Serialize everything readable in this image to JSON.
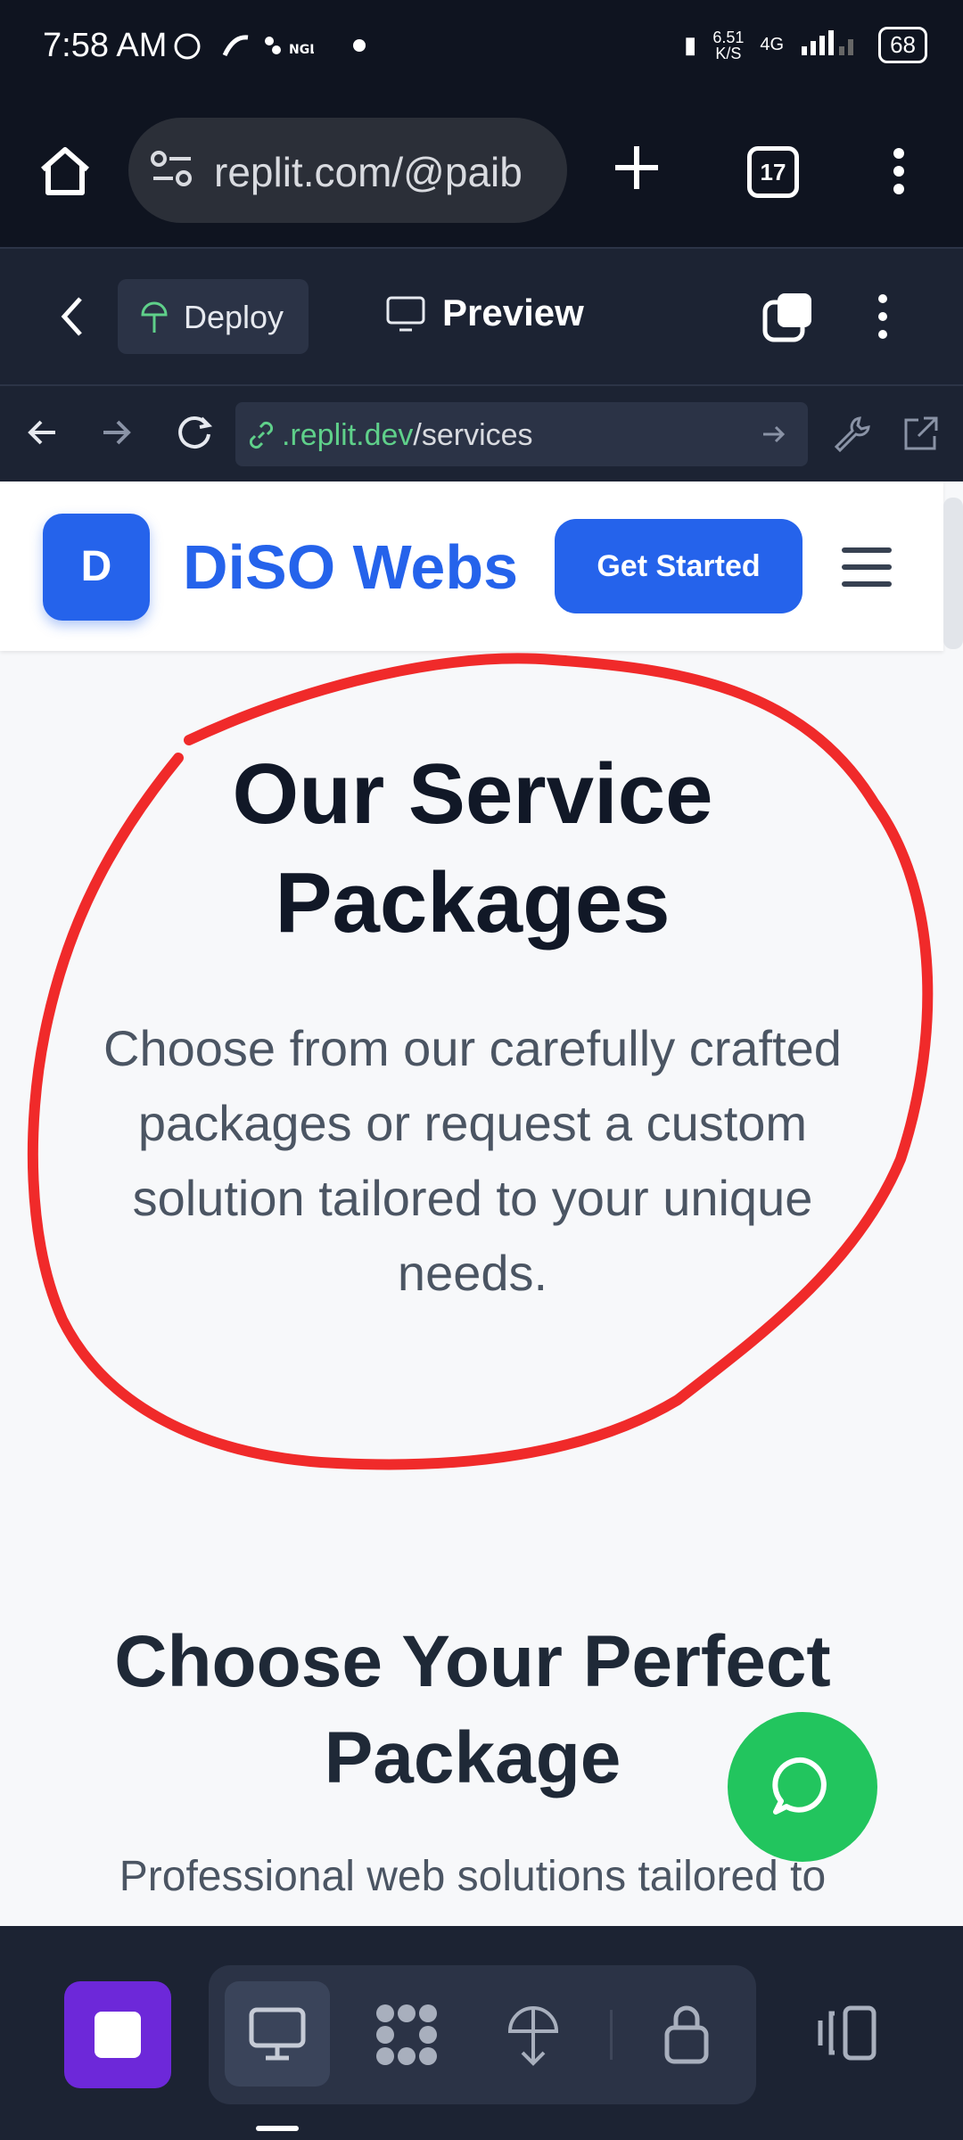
{
  "status_bar": {
    "time": "7:58 AM",
    "net_speed": "6.51",
    "net_unit": "K/S",
    "network": "4G",
    "battery": "68"
  },
  "browser": {
    "url": "replit.com/@paib",
    "tab_count": "17"
  },
  "replit_toolbar": {
    "deploy_label": "Deploy",
    "preview_label": "Preview"
  },
  "webview_address": {
    "domain": ".replit.dev",
    "path": "/services"
  },
  "site": {
    "logo_letter": "D",
    "brand": "DiSO Webs",
    "cta_label": "Get Started",
    "hero_title": "Our Service Packages",
    "hero_text": "Choose from our carefully crafted packages or request a custom solution tailored to your unique needs.",
    "section_title": "Choose Your Perfect Package",
    "section_text": "Professional web solutions tailored to"
  },
  "colors": {
    "brand_blue": "#2563eb",
    "annotation_red": "#f02a2a",
    "whatsapp_green": "#22c55e",
    "stop_purple": "#6d28d9"
  },
  "icons": [
    "home-icon",
    "site-settings-icon",
    "new-tab-icon",
    "tabs-icon",
    "more-icon",
    "back-icon",
    "deploy-icon",
    "monitor-icon",
    "copy-icon",
    "forward-icon",
    "reload-icon",
    "link-icon",
    "go-icon",
    "wrench-icon",
    "external-icon",
    "menu-icon",
    "chat-icon",
    "stop-icon",
    "workflow-icon",
    "network-icon",
    "lock-icon",
    "panel-icon"
  ]
}
